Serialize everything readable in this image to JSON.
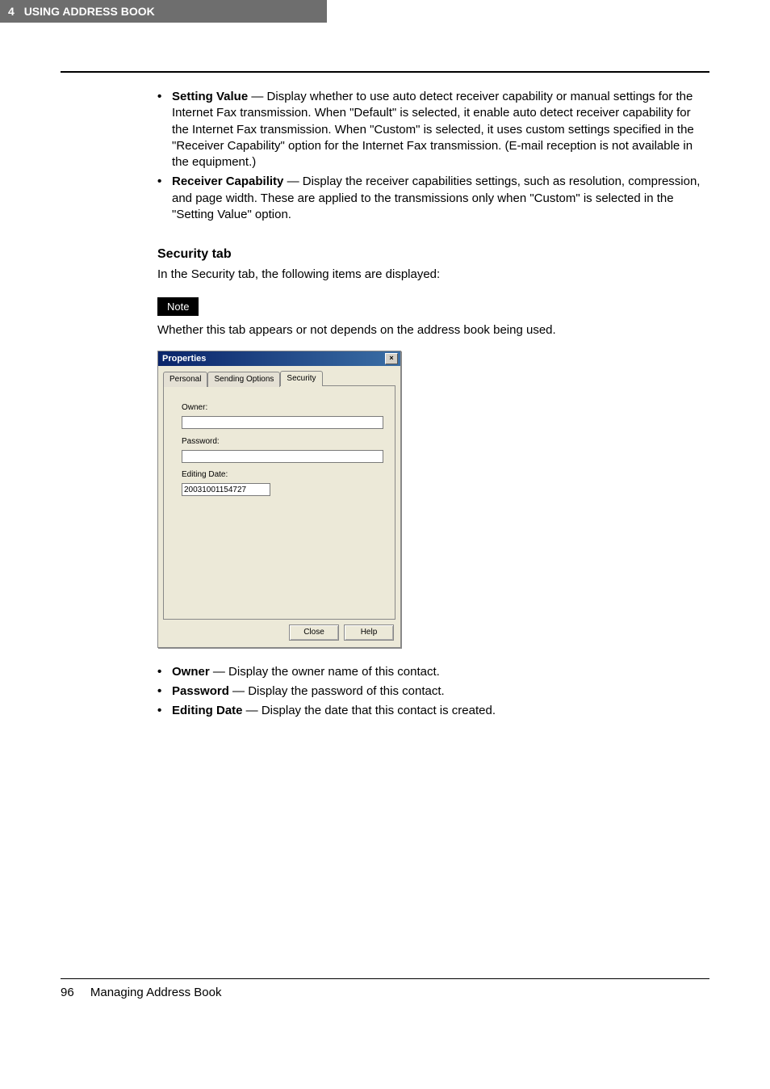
{
  "header": {
    "chapter_num": "4",
    "title": "USING ADDRESS BOOK"
  },
  "bullets1": [
    {
      "term": "Setting Value",
      "desc": " — Display whether to use auto detect receiver capability or manual settings for the Internet Fax transmission. When \"Default\" is selected, it enable auto detect receiver capability for the Internet Fax transmission. When \"Custom\" is selected, it uses custom settings specified in the \"Receiver Capability\" option for the Internet Fax transmission. (E-mail reception is not available in the equipment.)"
    },
    {
      "term": "Receiver Capability",
      "desc": " — Display the receiver capabilities settings, such as resolution, compression, and page width. These are applied to the transmissions only when \"Custom\" is selected in the \"Setting Value\" option."
    }
  ],
  "section_heading": "Security tab",
  "section_intro": "In the Security tab, the following items are displayed:",
  "note_label": "Note",
  "note_text": "Whether this tab appears or not depends on the address book being used.",
  "dialog": {
    "title": "Properties",
    "close": "×",
    "tabs": {
      "personal": "Personal",
      "sending": "Sending Options",
      "security": "Security"
    },
    "fields": {
      "owner_label": "Owner:",
      "owner_value": "",
      "password_label": "Password:",
      "password_value": "",
      "editing_label": "Editing Date:",
      "editing_value": "20031001154727"
    },
    "buttons": {
      "close": "Close",
      "help": "Help"
    }
  },
  "bullets2": [
    {
      "term": "Owner",
      "desc": " — Display the owner name of this contact."
    },
    {
      "term": "Password",
      "desc": " — Display the password of this contact."
    },
    {
      "term": "Editing Date",
      "desc": " — Display the date that this contact is created."
    }
  ],
  "footer": {
    "page": "96",
    "title": "Managing Address Book"
  }
}
